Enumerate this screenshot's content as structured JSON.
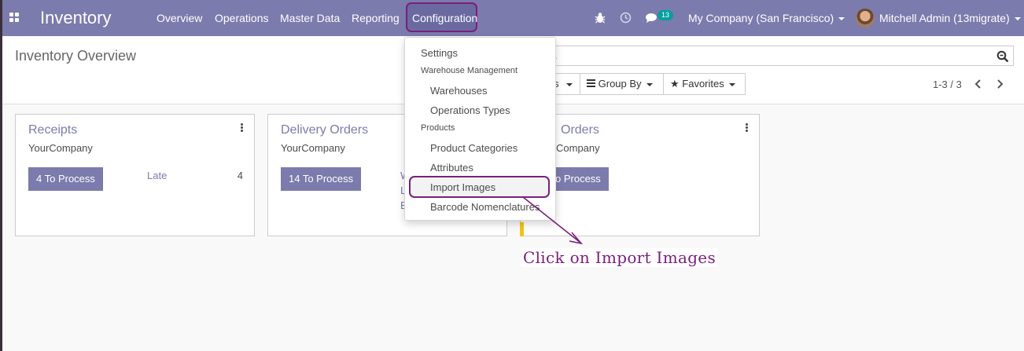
{
  "navbar": {
    "app_title": "Inventory",
    "menu": [
      "Overview",
      "Operations",
      "Master Data",
      "Reporting",
      "Configuration"
    ],
    "messages_count": "13",
    "company": "My Company (San Francisco)",
    "user": "Mitchell Admin (13migrate)"
  },
  "control_panel": {
    "page_title": "Inventory Overview",
    "search_partial": ".",
    "filters_partial": "s",
    "group_by": "Group By",
    "favorites": "Favorites",
    "pager": "1-3 / 3"
  },
  "cards": [
    {
      "title": "Receipts",
      "company": "YourCompany",
      "button": "4 To Process",
      "late_label": "Late",
      "late_count": "4"
    },
    {
      "title": "Delivery Orders",
      "company": "YourCompany",
      "button": "14 To Process",
      "links_partial": [
        "W",
        "L",
        "B"
      ]
    },
    {
      "title_partial": "Orders",
      "company_partial": "Company",
      "button_partial": "o Process"
    }
  ],
  "dropdown": {
    "settings": "Settings",
    "section_warehouse": "Warehouse Management",
    "warehouses": "Warehouses",
    "operations_types": "Operations Types",
    "section_products": "Products",
    "product_categories": "Product Categories",
    "attributes": "Attributes",
    "import_images": "Import Images",
    "barcode_nomenclatures": "Barcode Nomenclatures"
  },
  "annotation": {
    "text": "Click on Import Images"
  },
  "colors": {
    "navbar": "#7c7bad",
    "accent": "#7c7bad",
    "annotation": "#7a1f7a",
    "badge": "#00a09d"
  }
}
